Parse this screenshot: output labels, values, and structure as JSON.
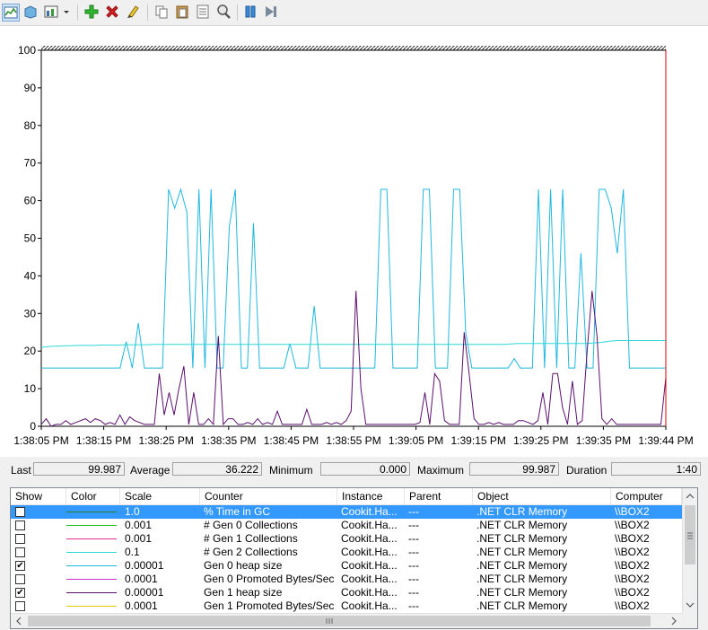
{
  "toolbar": {
    "buttons": [
      {
        "name": "view-graph-button",
        "icon": "line-graph-icon",
        "x": 0
      },
      {
        "name": "view-histogram-button",
        "icon": "histogram-icon",
        "x": 0
      },
      {
        "name": "change-graph-type-button",
        "icon": "graph-type-icon",
        "x": 0
      },
      {
        "name": "add-counter-button",
        "icon": "plus-icon",
        "x": 0
      },
      {
        "name": "delete-counter-button",
        "icon": "delete-x-icon",
        "x": 0
      },
      {
        "name": "highlight-button",
        "icon": "highlighter-icon",
        "x": 0
      },
      {
        "name": "copy-properties-button",
        "icon": "copy-icon",
        "x": 0
      },
      {
        "name": "paste-counter-list-button",
        "icon": "paste-icon",
        "x": 0
      },
      {
        "name": "properties-button",
        "icon": "properties-icon",
        "x": 0
      },
      {
        "name": "zoom-button",
        "icon": "magnifier-icon",
        "x": 0
      },
      {
        "name": "freeze-display-button",
        "icon": "pause-icon",
        "x": 0
      },
      {
        "name": "update-data-button",
        "icon": "step-icon",
        "x": 0
      }
    ]
  },
  "chart_data": {
    "type": "line",
    "ylim": [
      0,
      100
    ],
    "y_ticks": [
      "100",
      "90",
      "80",
      "70",
      "60",
      "50",
      "40",
      "30",
      "20",
      "10",
      "0"
    ],
    "x_ticks": [
      "1:38:05 PM",
      "1:38:15 PM",
      "1:38:25 PM",
      "1:38:35 PM",
      "1:38:45 PM",
      "1:38:55 PM",
      "1:39:05 PM",
      "1:39:15 PM",
      "1:39:25 PM",
      "1:39:35 PM",
      "1:39:44 PM"
    ],
    "grid": false,
    "series": [
      {
        "name": "Gen 0 heap size",
        "color": "#1fb8e0",
        "values": [
          15.5,
          15.5,
          15.5,
          15.5,
          15.5,
          15.5,
          15.5,
          15.5,
          15.5,
          15.5,
          15.5,
          15.5,
          15.5,
          15.5,
          22.5,
          15.5,
          27.5,
          15.5,
          15.5,
          15.5,
          15.5,
          63,
          58,
          63,
          57,
          15.5,
          63,
          15.5,
          63,
          15.5,
          15.5,
          53,
          63,
          15.5,
          15.5,
          54,
          15.5,
          15.5,
          15.5,
          15.5,
          15.5,
          22,
          15.5,
          15.5,
          15.5,
          32,
          15.5,
          15.5,
          15.5,
          15.5,
          15.5,
          15.5,
          15.5,
          15.5,
          15.5,
          15.5,
          63,
          63,
          15.5,
          15.5,
          15.5,
          15.5,
          15.5,
          63,
          63,
          15.5,
          15.5,
          15.5,
          63,
          63,
          25,
          15.5,
          15.5,
          15.5,
          15.5,
          15.5,
          15.5,
          15.5,
          18,
          15.5,
          15.5,
          15.5,
          63,
          15.5,
          63,
          15.5,
          63,
          15.5,
          15.5,
          46,
          15.5,
          15.5,
          63,
          63,
          58,
          46,
          63,
          15.5,
          15.5,
          15.5,
          15.5,
          15.5,
          15.5,
          15.5
        ]
      },
      {
        "name": "# Gen 2 Collections",
        "color": "#2ed8d8",
        "values": [
          21,
          21.2,
          21.3,
          21.3,
          21.4,
          21.4,
          21.5,
          21.5,
          21.5,
          21.5,
          21.6,
          21.6,
          21.6,
          21.6,
          21.7,
          21.7,
          21.7,
          21.7,
          21.7,
          21.8,
          21.8,
          21.8,
          21.8,
          21.8,
          21.8,
          21.8,
          21.8,
          21.8,
          21.8,
          21.8,
          21.8,
          21.8,
          21.8,
          21.8,
          21.8,
          21.8,
          21.8,
          21.8,
          21.8,
          21.8,
          21.8,
          21.8,
          21.8,
          21.8,
          21.8,
          21.8,
          21.8,
          21.8,
          21.8,
          21.8,
          21.8,
          21.8,
          21.8,
          21.8,
          21.8,
          21.8,
          21.8,
          21.8,
          21.8,
          21.8,
          21.8,
          21.8,
          21.8,
          21.8,
          21.8,
          21.8,
          21.8,
          21.8,
          21.8,
          21.8,
          21.8,
          21.8,
          21.8,
          21.8,
          21.8,
          21.8,
          21.8,
          21.8,
          21.8,
          21.9,
          22,
          22,
          22,
          22,
          22,
          22,
          22,
          22,
          22,
          22,
          22,
          22,
          22,
          22.2,
          22.3,
          22.5,
          22.7,
          22.8,
          22.8,
          22.8,
          22.8,
          22.8,
          22.8,
          22.8,
          22.8,
          22.8
        ]
      },
      {
        "name": "Gen 1 heap size",
        "color": "#5a0f6e",
        "values": [
          0.5,
          2,
          0,
          0.5,
          0.5,
          1.5,
          0.5,
          1,
          1.5,
          2,
          1,
          2,
          1.5,
          0.5,
          1,
          0.5,
          3,
          0.5,
          2.5,
          1.5,
          1,
          0.5,
          0.5,
          0.5,
          14,
          3,
          9,
          3,
          10,
          16,
          0.5,
          9,
          0.5,
          0.5,
          2,
          0.5,
          24,
          0.5,
          2,
          2,
          0.5,
          0.5,
          1,
          0.5,
          2,
          0.5,
          1,
          0.5,
          4,
          0.5,
          0.5,
          0.5,
          0.5,
          0.5,
          4.5,
          0.5,
          0.5,
          0.5,
          1,
          0.5,
          1,
          0.5,
          1.5,
          4,
          36,
          10,
          0.5,
          0.5,
          0.5,
          0.5,
          0.5,
          0.5,
          0.5,
          0.5,
          0.5,
          0.5,
          0.5,
          1,
          9,
          0.5,
          14,
          12,
          1.5,
          0.5,
          0.5,
          0.5,
          25,
          14,
          2,
          0.5,
          0.5,
          1,
          0.5,
          1,
          0.5,
          0.5,
          0.5,
          1.5,
          1.5,
          1,
          0.5,
          1.5,
          9,
          0.5,
          14,
          14,
          5,
          0.5,
          12,
          0.5,
          1.5,
          20,
          36,
          24,
          2,
          0.5,
          2,
          0.5,
          0.5,
          0.5,
          0.5,
          0.5,
          0.5,
          0.5,
          0.5,
          0.5,
          0.5,
          13
        ]
      }
    ]
  },
  "stats": {
    "last_label": "Last",
    "last_value": "99.987",
    "average_label": "Average",
    "average_value": "36.222",
    "minimum_label": "Minimum",
    "minimum_value": "0.000",
    "maximum_label": "Maximum",
    "maximum_value": "99.987",
    "duration_label": "Duration",
    "duration_value": "1:40"
  },
  "legend": {
    "headers": {
      "show": "Show",
      "color": "Color",
      "scale": "Scale",
      "counter": "Counter",
      "instance": "Instance",
      "parent": "Parent",
      "object": "Object",
      "computer": "Computer"
    },
    "rows": [
      {
        "checked": false,
        "selected": true,
        "color": "#2a7f2a",
        "scale": "1.0",
        "counter": "% Time in GC",
        "instance": "Cookit.Ha...",
        "parent": "---",
        "object": ".NET CLR Memory",
        "computer": "\\\\BOX2"
      },
      {
        "checked": false,
        "selected": false,
        "color": "#22c422",
        "scale": "0.001",
        "counter": "# Gen 0 Collections",
        "instance": "Cookit.Ha...",
        "parent": "---",
        "object": ".NET CLR Memory",
        "computer": "\\\\BOX2"
      },
      {
        "checked": false,
        "selected": false,
        "color": "#e03090",
        "scale": "0.001",
        "counter": "# Gen 1 Collections",
        "instance": "Cookit.Ha...",
        "parent": "---",
        "object": ".NET CLR Memory",
        "computer": "\\\\BOX2"
      },
      {
        "checked": false,
        "selected": false,
        "color": "#2ed8d8",
        "scale": "0.1",
        "counter": "# Gen 2 Collections",
        "instance": "Cookit.Ha...",
        "parent": "---",
        "object": ".NET CLR Memory",
        "computer": "\\\\BOX2"
      },
      {
        "checked": true,
        "selected": false,
        "color": "#1fb8e0",
        "scale": "0.00001",
        "counter": "Gen 0 heap size",
        "instance": "Cookit.Ha...",
        "parent": "---",
        "object": ".NET CLR Memory",
        "computer": "\\\\BOX2"
      },
      {
        "checked": false,
        "selected": false,
        "color": "#d030d0",
        "scale": "0.0001",
        "counter": "Gen 0 Promoted Bytes/Sec",
        "instance": "Cookit.Ha...",
        "parent": "---",
        "object": ".NET CLR Memory",
        "computer": "\\\\BOX2"
      },
      {
        "checked": true,
        "selected": false,
        "color": "#5a0f6e",
        "scale": "0.00001",
        "counter": "Gen 1 heap size",
        "instance": "Cookit.Ha...",
        "parent": "---",
        "object": ".NET CLR Memory",
        "computer": "\\\\BOX2"
      },
      {
        "checked": false,
        "selected": false,
        "color": "#e8c800",
        "scale": "0.0001",
        "counter": "Gen 1 Promoted Bytes/Sec",
        "instance": "Cookit.Ha...",
        "parent": "---",
        "object": ".NET CLR Memory",
        "computer": "\\\\BOX2"
      }
    ]
  }
}
